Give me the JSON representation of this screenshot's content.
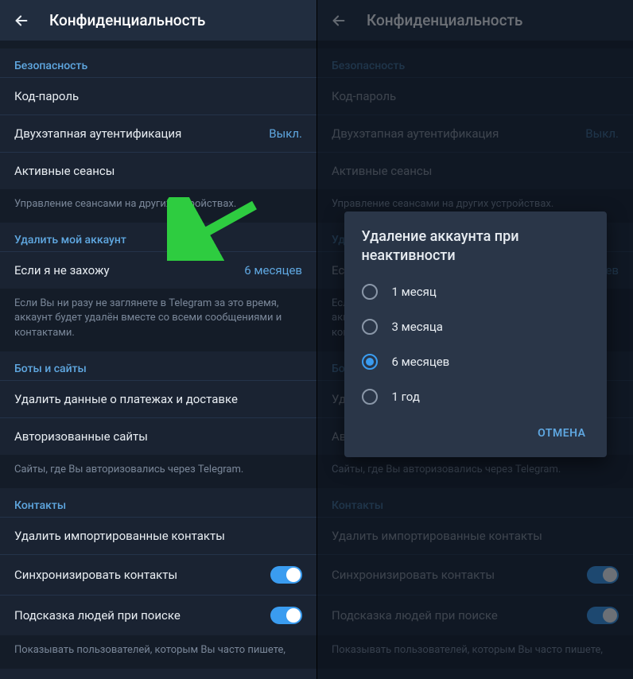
{
  "header": {
    "title": "Конфиденциальность"
  },
  "security": {
    "header": "Безопасность",
    "passcode": "Код-пароль",
    "two_step": "Двухэтапная аутентификация",
    "two_step_value": "Выкл.",
    "active_sessions": "Активные сеансы",
    "footer": "Управление сеансами на других устройствах."
  },
  "delete_account": {
    "header": "Удалить мой аккаунт",
    "if_away": "Если я не захожу",
    "if_away_value": "6 месяцев",
    "footer": "Если Вы ни разу не заглянете в Telegram за это время, аккаунт будет удалён вместе со всеми сообщениями и контактами."
  },
  "bots": {
    "header": "Боты и сайты",
    "delete_payment": "Удалить данные о платежах и доставке",
    "authorized_sites": "Авторизованные сайты",
    "footer": "Сайты, где Вы авторизовались через Telegram."
  },
  "contacts": {
    "header": "Контакты",
    "delete_imported": "Удалить импортированные контакты",
    "sync": "Синхронизировать контакты",
    "suggest": "Подсказка людей при поиске",
    "footer": "Показывать пользователей, которым Вы часто пишете,"
  },
  "dialog": {
    "title": "Удаление аккаунта при неактивности",
    "options": [
      "1 месяц",
      "3 месяца",
      "6 месяцев",
      "1 год"
    ],
    "selected_index": 2,
    "cancel": "ОТМЕНА"
  }
}
